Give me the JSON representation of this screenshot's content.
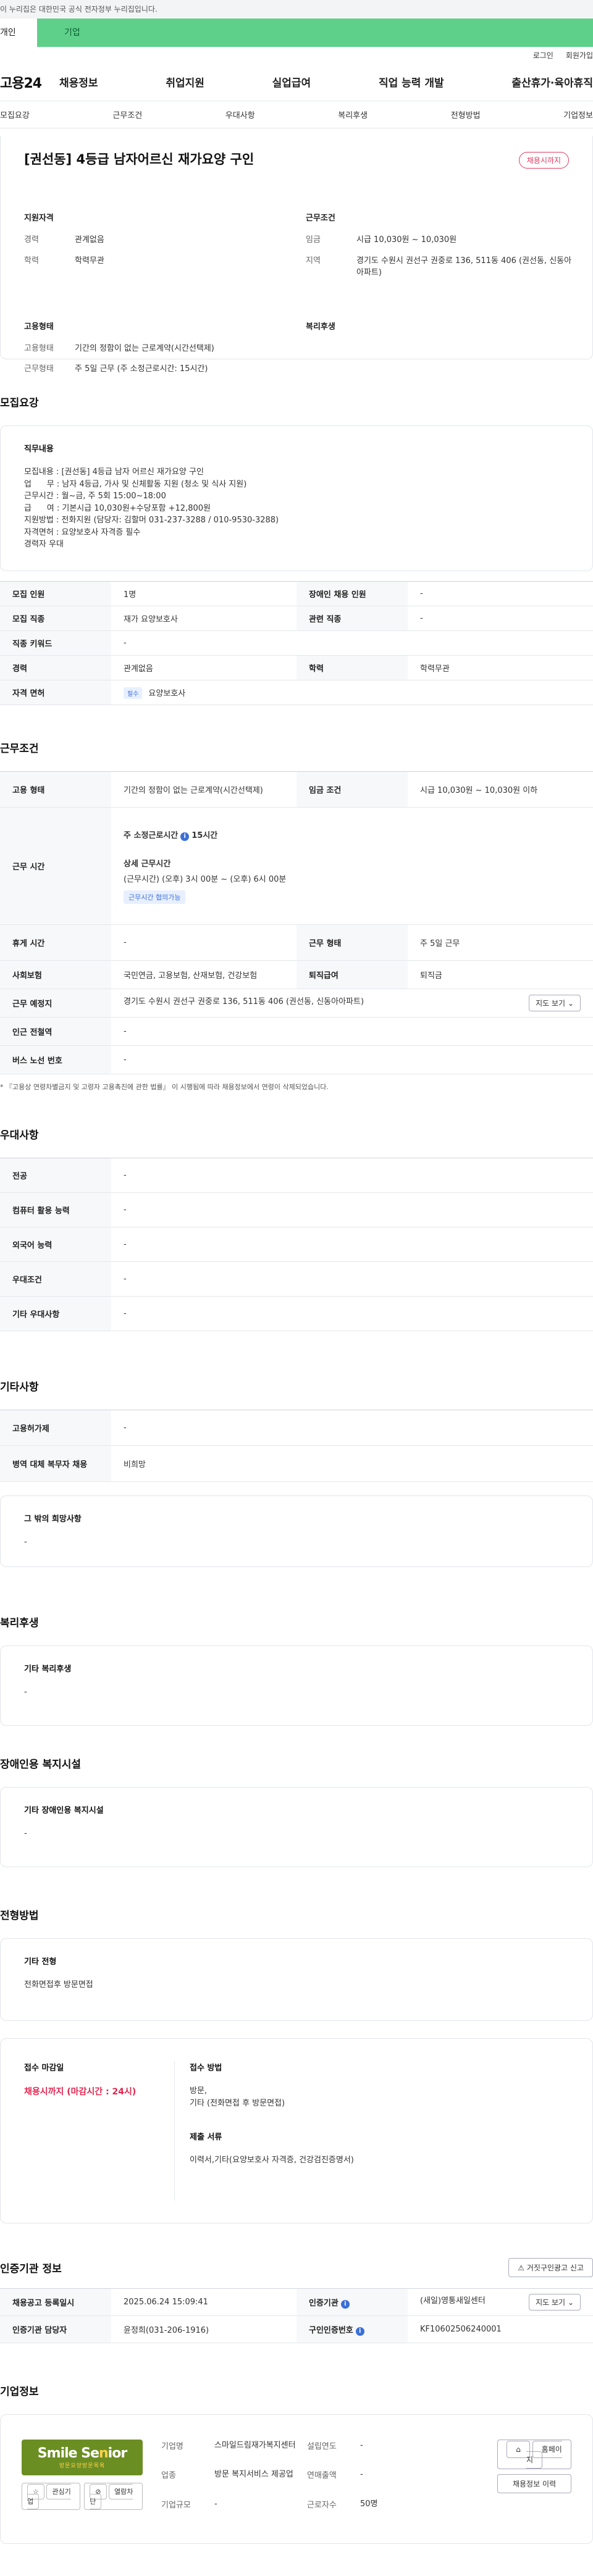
{
  "gov_banner": "이 누리집은 대한민국 공식 전자정부 누리집입니다.",
  "tabs": {
    "person": "개인",
    "company": "기업"
  },
  "util": {
    "login": "로그인",
    "signup": "회원가입"
  },
  "logo": "고용24",
  "gnb": [
    "채용정보",
    "취업지원",
    "실업급여",
    "직업 능력 개발",
    "출산휴가·육아휴직"
  ],
  "anchors": [
    "모집요강",
    "근무조건",
    "우대사항",
    "복리후생",
    "전형방법",
    "기업정보"
  ],
  "title": "[권선동] 4등급 남자어르신 재가요양 구인",
  "deadline_badge": "채용시까지",
  "summary": {
    "qual_h": "지원자격",
    "career_k": "경력",
    "career_v": "관계없음",
    "edu_k": "학력",
    "edu_v": "학력무관",
    "cond_h": "근무조건",
    "wage_k": "임금",
    "wage_v": "시급 10,030원 ~ 10,030원",
    "loc_k": "지역",
    "loc_v": "경기도 수원시 권선구 권중로 136, 511동 406 (권선동, 신동아아파트)",
    "emp_h": "고용형태",
    "emp_type_k": "고용형태",
    "emp_type_v": "기간의 정함이 없는 근로계약(시간선택제)",
    "work_type_k": "근무형태",
    "work_type_v": "주 5일 근무 (주 소정근로시간: 15시간)",
    "welfare_h": "복리후생"
  },
  "recruit": {
    "section": "모집요강",
    "duty_h": "직무내용",
    "duty_text": "모집내용 : [권선동] 4등급 남자 어르신 재가요양 구인\n업      무 : 남자 4등급, 가사 및 신체활동 지원 (청소 및 식사 지원)\n근무시간 : 월~금, 주 5회 15:00~18:00\n급      여 : 기본시급 10,030원+수당포함 +12,800원\n지원방법 : 전화지원 (담당자: 김할머 031-237-3288 / 010-9530-3288)\n자격면허 : 요양보호사 자격증 필수\n경력자 우대",
    "rows": {
      "headcount_k": "모집 인원",
      "headcount_v": "1명",
      "disabled_k": "장애인 채용 인원",
      "disabled_v": "-",
      "job_k": "모집 직종",
      "job_v": "재가 요양보호사",
      "related_k": "관련 직종",
      "related_v": "-",
      "keyword_k": "직종 키워드",
      "keyword_v": "-",
      "career_k": "경력",
      "career_v": "관계없음",
      "edu_k": "학력",
      "edu_v": "학력무관",
      "license_k": "자격 면허",
      "license_tag": "필수",
      "license_v": "요양보호사"
    }
  },
  "conditions": {
    "section": "근무조건",
    "emp_k": "고용 형태",
    "emp_v": "기간의 정함이 없는 근로계약(시간선택제)",
    "wage_k": "임금 조건",
    "wage_v": "시급 10,030원 ~ 10,030원 이하",
    "hours_k": "근무 시간",
    "hours_main": "주 소정근로시간",
    "hours_num": "15시간",
    "hours_detail_h": "상세 근무시간",
    "hours_detail_v": "(근무시간) (오후) 3시 00분 ~ (오후) 6시 00분",
    "hours_tag": "근무시간 협의가능",
    "break_k": "휴게 시간",
    "break_v": "-",
    "worktype_k": "근무 형태",
    "worktype_v": "주 5일 근무",
    "insurance_k": "사회보험",
    "insurance_v": "국민연금, 고용보험, 산재보험, 건강보험",
    "retire_k": "퇴직급여",
    "retire_v": "퇴직금",
    "place_k": "근무 예정지",
    "place_v": "경기도 수원시 권선구 권중로 136, 511동 406 (권선동, 신동아아파트)",
    "map_btn": "지도 보기",
    "subway_k": "인근 전철역",
    "subway_v": "-",
    "bus_k": "버스 노선 번호",
    "bus_v": "-",
    "note": "* 『고용상 연령차별금지 및 고령자 고용촉진에 관한 법률』 이 시행됨에 따라 채용정보에서 연령이 삭제되었습니다."
  },
  "preference": {
    "section": "우대사항",
    "rows": [
      {
        "k": "전공",
        "v": "-"
      },
      {
        "k": "컴퓨터 활용 능력",
        "v": "-"
      },
      {
        "k": "외국어 능력",
        "v": "-"
      },
      {
        "k": "우대조건",
        "v": "-"
      },
      {
        "k": "기타 우대사항",
        "v": "-"
      }
    ]
  },
  "etc": {
    "section": "기타사항",
    "permit_k": "고용허가제",
    "permit_v": "-",
    "military_k": "병역 대체 복무자 채용",
    "military_v": "비희망",
    "other_h": "그 밖의 희망사항",
    "other_v": "-"
  },
  "welfare": {
    "section": "복리후생",
    "h": "기타 복리후생",
    "v": "-"
  },
  "disabled_facility": {
    "section": "장애인용 복지시설",
    "h": "기타 장애인용 복지시설",
    "v": "-"
  },
  "selection": {
    "section": "전형방법",
    "other_h": "기타 전형",
    "other_v": "전화면접후 방문면접",
    "deadline_h": "접수 마감일",
    "deadline_v": "채용시까지 (마감시간 : 24시)",
    "method_h": "접수 방법",
    "method_v": "방문,\n기타 (전화면접 후 방문면접)",
    "docs_h": "제출 서류",
    "docs_v": "이력서,기타(요양보호사 자격증, 건강검진증명서)"
  },
  "cert": {
    "section": "인증기관 정보",
    "report_btn": "거짓구인광고 신고",
    "reg_k": "채용공고 등록일시",
    "reg_v": "2025.06.24 15:09:41",
    "org_k": "인증기관",
    "org_v": "(새일)영통새일센터",
    "map_btn": "지도 보기",
    "contact_k": "인증기관 담당자",
    "contact_v": "윤정희(031-206-1916)",
    "no_k": "구인인증번호",
    "no_v": "KF10602506240001"
  },
  "company": {
    "section": "기업정보",
    "logo_main_a": "Smile Se",
    "logo_main_b": "n",
    "logo_main_c": "ior",
    "logo_sub": "방문요양방문목욕",
    "fav_btn": "관심기업",
    "block_btn": "열람차단",
    "name_k": "기업명",
    "name_v": "스마일드림재가복지센터",
    "industry_k": "업종",
    "industry_v": "방문 복지서비스 제공업",
    "size_k": "기업규모",
    "size_v": "-",
    "founded_k": "설립연도",
    "founded_v": "-",
    "sales_k": "연매출액",
    "sales_v": "-",
    "employees_k": "근로자수",
    "employees_v": "50명",
    "homepage_btn": "홈페이지",
    "jobs_btn": "채용정보 이력"
  }
}
